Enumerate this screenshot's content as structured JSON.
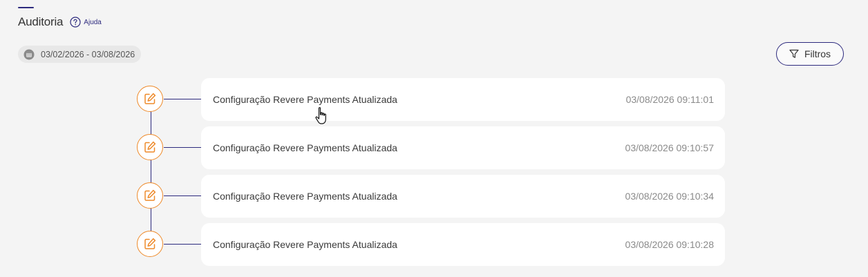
{
  "page": {
    "title": "Auditoria",
    "help_label": "Ajuda",
    "date_range": "03/02/2026 - 03/08/2026",
    "filters_label": "Filtros"
  },
  "events": [
    {
      "title": "Configuração Revere Payments Atualizada",
      "time": "03/08/2026 09:11:01"
    },
    {
      "title": "Configuração Revere Payments Atualizada",
      "time": "03/08/2026 09:10:57"
    },
    {
      "title": "Configuração Revere Payments Atualizada",
      "time": "03/08/2026 09:10:34"
    },
    {
      "title": "Configuração Revere Payments Atualizada",
      "time": "03/08/2026 09:10:28"
    }
  ],
  "icons": {
    "help": "question-circle-icon",
    "date": "calendar-icon",
    "filters": "filter-funnel-icon",
    "event": "edit-pencil-square-icon",
    "cursor": "hand-pointer-cursor"
  },
  "colors": {
    "background": "#f4f4f4",
    "card": "#ffffff",
    "primary": "#2d2a7e",
    "accent_orange": "#ee8a2a",
    "text": "#3a3a3a",
    "muted_text": "#8a8a8a"
  }
}
